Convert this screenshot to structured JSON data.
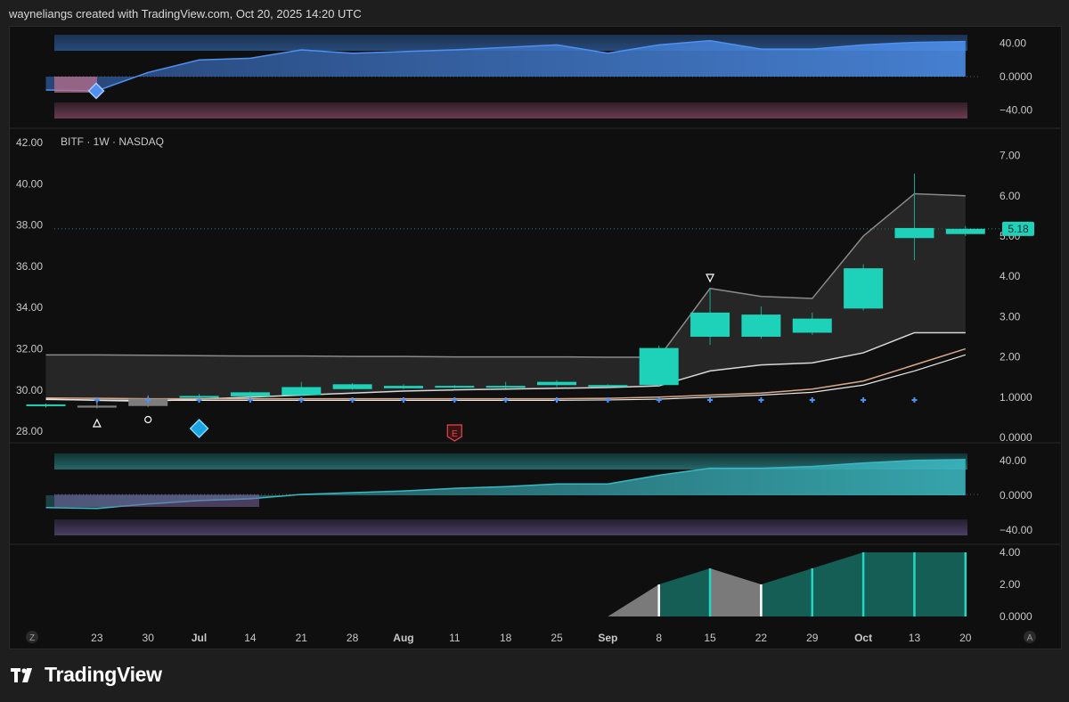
{
  "header": {
    "attribution": "wayneliangs created with TradingView.com, Oct 20, 2025 14:20 UTC"
  },
  "footer": {
    "brand": "TradingView"
  },
  "legend": {
    "symbol": "BITF · 1W · NASDAQ"
  },
  "colors": {
    "bull": "#1ed2b9",
    "bear": "#7d7d7d",
    "blue": "#4e91f0",
    "teal": "#3ab8c2",
    "purple": "#7c66a3",
    "pink": "#c2708a",
    "band": "#3c3c3c"
  },
  "chart_data": [
    {
      "type": "area",
      "panel": "top-oscillator",
      "axis_ticks": [
        "40.00",
        "0.0000",
        "−40.00"
      ],
      "ylim": [
        -48,
        48
      ],
      "x": [
        "Jun 16",
        "Jun 23",
        "Jun 30",
        "Jul 7",
        "Jul 14",
        "Jul 21",
        "Jul 28",
        "Aug 4",
        "Aug 11",
        "Aug 18",
        "Aug 25",
        "Sep 1",
        "Sep 8",
        "Sep 15",
        "Sep 22",
        "Sep 29",
        "Oct 6",
        "Oct 13",
        "Oct 20"
      ],
      "values": [
        -16,
        -17,
        5,
        20,
        22,
        32,
        28,
        30,
        32,
        35,
        38,
        28,
        38,
        43,
        33,
        33,
        38,
        41,
        42
      ]
    },
    {
      "type": "candlestick",
      "panel": "price",
      "legend": "BITF · 1W · NASDAQ",
      "left_axis_ticks": [
        "42.00",
        "40.00",
        "38.00",
        "36.00",
        "34.00",
        "32.00",
        "30.00",
        "28.00"
      ],
      "right_axis_ticks": [
        "7.00",
        "6.00",
        "5.00",
        "4.00",
        "3.00",
        "2.00",
        "1.0000",
        "0.0000"
      ],
      "ylim": [
        0,
        7.3
      ],
      "last_price_label": "5.18",
      "x_labels": [
        "23",
        "30",
        "Jul",
        "14",
        "21",
        "28",
        "Aug",
        "11",
        "18",
        "25",
        "Sep",
        "8",
        "15",
        "22",
        "29",
        "Oct",
        "13",
        "20"
      ],
      "candles": [
        {
          "date": "Jun 16",
          "open": 0.78,
          "high": 0.84,
          "low": 0.74,
          "close": 0.82
        },
        {
          "date": "Jun 23",
          "open": 0.79,
          "high": 0.95,
          "low": 0.72,
          "close": 0.74
        },
        {
          "date": "Jun 30",
          "open": 0.96,
          "high": 1.04,
          "low": 0.76,
          "close": 0.78
        },
        {
          "date": "Jul 7",
          "open": 1.0,
          "high": 1.08,
          "low": 0.94,
          "close": 1.03
        },
        {
          "date": "Jul 14",
          "open": 1.02,
          "high": 1.14,
          "low": 1.0,
          "close": 1.12
        },
        {
          "date": "Jul 21",
          "open": 1.05,
          "high": 1.38,
          "low": 1.03,
          "close": 1.25
        },
        {
          "date": "Jul 28",
          "open": 1.2,
          "high": 1.35,
          "low": 1.18,
          "close": 1.32
        },
        {
          "date": "Aug 4",
          "open": 1.22,
          "high": 1.32,
          "low": 1.2,
          "close": 1.28
        },
        {
          "date": "Aug 11",
          "open": 1.26,
          "high": 1.3,
          "low": 1.22,
          "close": 1.28
        },
        {
          "date": "Aug 18",
          "open": 1.24,
          "high": 1.38,
          "low": 1.22,
          "close": 1.28
        },
        {
          "date": "Aug 25",
          "open": 1.3,
          "high": 1.42,
          "low": 1.25,
          "close": 1.38
        },
        {
          "date": "Sep 1",
          "open": 1.28,
          "high": 1.32,
          "low": 1.25,
          "close": 1.3
        },
        {
          "date": "Sep 8",
          "open": 1.3,
          "high": 2.28,
          "low": 1.28,
          "close": 2.22
        },
        {
          "date": "Sep 15",
          "open": 2.5,
          "high": 3.7,
          "low": 2.3,
          "close": 3.1
        },
        {
          "date": "Sep 22",
          "open": 2.5,
          "high": 3.25,
          "low": 2.45,
          "close": 3.05
        },
        {
          "date": "Sep 29",
          "open": 2.6,
          "high": 3.1,
          "low": 2.55,
          "close": 2.95
        },
        {
          "date": "Oct 6",
          "open": 3.2,
          "high": 4.3,
          "low": 3.15,
          "close": 4.2
        },
        {
          "date": "Oct 13",
          "open": 4.95,
          "high": 6.55,
          "low": 4.4,
          "close": 5.2
        },
        {
          "date": "Oct 20",
          "open": 5.05,
          "high": 5.25,
          "low": 5.0,
          "close": 5.18
        }
      ],
      "markers": [
        {
          "date": "Jun 23",
          "shape": "up-triangle"
        },
        {
          "date": "Jun 30",
          "shape": "circle"
        },
        {
          "date": "Sep 15",
          "shape": "down-triangle"
        },
        {
          "date": "Jul 7",
          "shape": "diamond"
        },
        {
          "date": "Aug 11",
          "shape": "earnings",
          "label": "E"
        }
      ]
    },
    {
      "type": "area",
      "panel": "middle-oscillator",
      "axis_ticks": [
        "40.00",
        "0.0000",
        "−40.00"
      ],
      "ylim": [
        -50,
        50
      ],
      "x": [
        "Jun 16",
        "Jun 23",
        "Jun 30",
        "Jul 7",
        "Jul 14",
        "Jul 21",
        "Jul 28",
        "Aug 4",
        "Aug 11",
        "Aug 18",
        "Aug 25",
        "Sep 1",
        "Sep 8",
        "Sep 15",
        "Sep 22",
        "Sep 29",
        "Oct 6",
        "Oct 13",
        "Oct 20"
      ],
      "values": [
        -14,
        -15,
        -10,
        -6,
        -4,
        1,
        3,
        5,
        8,
        10,
        13,
        13,
        23,
        31,
        31,
        33,
        37,
        40,
        41
      ]
    },
    {
      "type": "area",
      "panel": "bottom-counter",
      "axis_ticks": [
        "4.00",
        "2.00",
        "0.0000"
      ],
      "ylim": [
        0,
        4
      ],
      "x": [
        "Sep 1",
        "Sep 8",
        "Sep 15",
        "Sep 22",
        "Sep 29",
        "Oct 6",
        "Oct 13",
        "Oct 20"
      ],
      "values": [
        0,
        2,
        3,
        2,
        3,
        4,
        4,
        4
      ]
    }
  ]
}
